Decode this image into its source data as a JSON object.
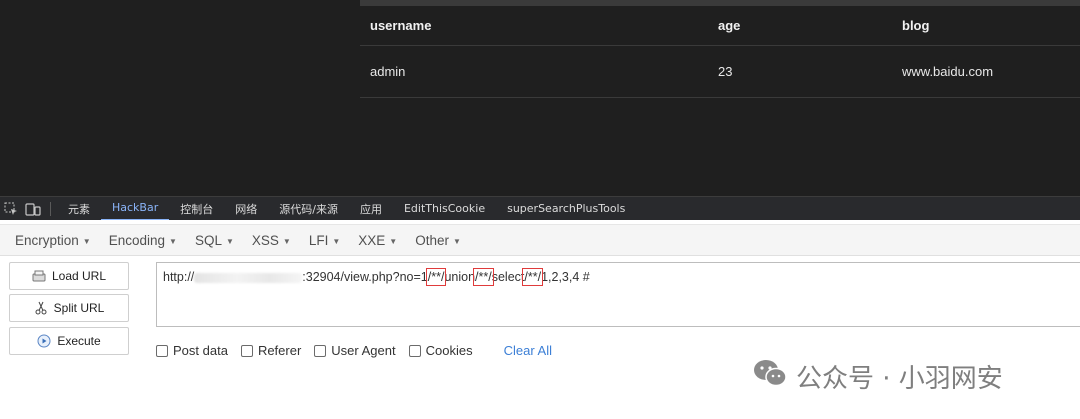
{
  "table": {
    "headers": [
      "username",
      "age",
      "blog"
    ],
    "rows": [
      [
        "admin",
        "23",
        "www.baidu.com"
      ]
    ]
  },
  "devtools": {
    "icons": [
      "inspect-element-icon",
      "device-toolbar-icon"
    ],
    "tabs": [
      "元素",
      "HackBar",
      "控制台",
      "网络",
      "源代码/来源",
      "应用",
      "EditThisCookie",
      "superSearchPlusTools"
    ],
    "active_tab": "HackBar",
    "accent": "#8ab4f8"
  },
  "hackbar": {
    "menus": [
      "Encryption",
      "Encoding",
      "SQL",
      "XSS",
      "LFI",
      "XXE",
      "Other"
    ],
    "buttons": {
      "load_url": "Load URL",
      "split_url": "Split URL",
      "execute": "Execute"
    },
    "url": {
      "p1": "http://",
      "p2": ":32904/view.php?no=1",
      "c1": "/**/",
      "p3": "union",
      "c2": "/**/",
      "p4": "select",
      "c3": "/**/",
      "p5": "1,2,3,4 #"
    },
    "options": {
      "post_data": "Post data",
      "referer": "Referer",
      "user_agent": "User Agent",
      "cookies": "Cookies",
      "clear_all": "Clear All"
    },
    "highlight_color": "#e03b3b",
    "link_color": "#3c7fd6"
  },
  "watermark": {
    "text": "公众号 · 小羽网安",
    "icon": "wechat-icon"
  }
}
